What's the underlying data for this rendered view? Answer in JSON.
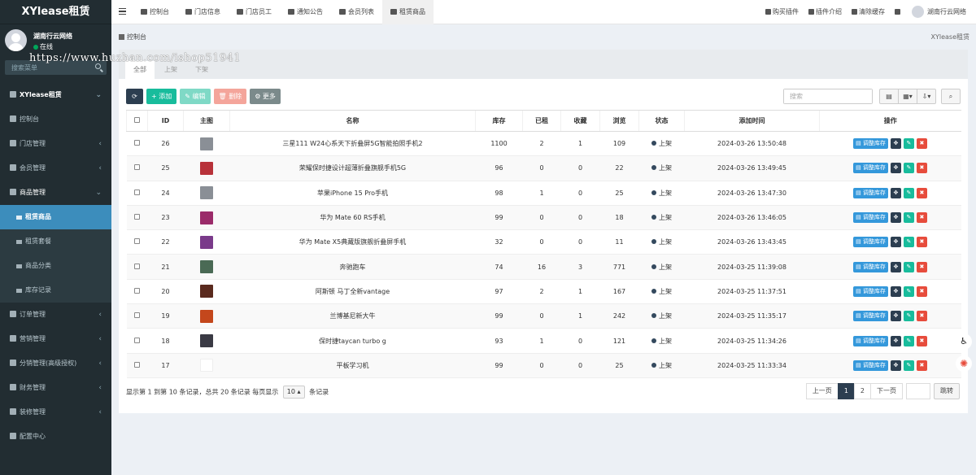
{
  "app": {
    "brand": "XYlease租赁"
  },
  "user": {
    "name": "湖南行云网络",
    "status": "在线"
  },
  "sidebar_search": {
    "placeholder": "搜索菜单"
  },
  "watermark": "https://www.huzhan.com/ishop51941",
  "sidebar": {
    "header": "XYlease租赁",
    "items": [
      {
        "label": "控制台"
      },
      {
        "label": "门店管理"
      },
      {
        "label": "会员管理"
      },
      {
        "label": "商品管理"
      },
      {
        "label": "订单管理"
      },
      {
        "label": "营销管理"
      },
      {
        "label": "分销管理(高级授权)"
      },
      {
        "label": "财务管理"
      },
      {
        "label": "装修管理"
      },
      {
        "label": "配置中心"
      }
    ],
    "sub": [
      {
        "label": "租赁商品"
      },
      {
        "label": "租赁套餐"
      },
      {
        "label": "商品分类"
      },
      {
        "label": "库存记录"
      }
    ]
  },
  "topnav": {
    "tabs": [
      {
        "label": "控制台"
      },
      {
        "label": "门店信息"
      },
      {
        "label": "门店员工"
      },
      {
        "label": "通知公告"
      },
      {
        "label": "会员列表"
      },
      {
        "label": "租赁商品"
      }
    ],
    "right": [
      {
        "label": "购买插件"
      },
      {
        "label": "插件介绍"
      },
      {
        "label": "清除缓存"
      }
    ],
    "user_name": "湖南行云网络"
  },
  "breadcrumb": {
    "label": "控制台",
    "app": "XYlease租赁"
  },
  "panel_tabs": [
    {
      "label": "全部"
    },
    {
      "label": "上架"
    },
    {
      "label": "下架"
    }
  ],
  "toolbar": {
    "add": "添加",
    "edit": "编辑",
    "delete": "删除",
    "more": "更多"
  },
  "search": {
    "placeholder": "搜索"
  },
  "table": {
    "headers": [
      "ID",
      "主图",
      "名称",
      "库存",
      "已租",
      "收藏",
      "浏览",
      "状态",
      "添加时间",
      "操作"
    ],
    "rows": [
      {
        "id": "26",
        "name": "三星111 W24心系天下折叠屏5G智能拍照手机2",
        "stock": "1100",
        "rented": "2",
        "fav": "1",
        "views": "109",
        "status": "上架",
        "time": "2024-03-26 13:50:48",
        "thumb": "#8a8f96"
      },
      {
        "id": "25",
        "name": "荣耀保时捷设计超薄折叠旗舰手机5G",
        "stock": "96",
        "rented": "0",
        "fav": "0",
        "views": "22",
        "status": "上架",
        "time": "2024-03-26 13:49:45",
        "thumb": "#b8323a"
      },
      {
        "id": "24",
        "name": "苹果iPhone 15 Pro手机",
        "stock": "98",
        "rented": "1",
        "fav": "0",
        "views": "25",
        "status": "上架",
        "time": "2024-03-26 13:47:30",
        "thumb": "#8a8f96"
      },
      {
        "id": "23",
        "name": "华为 Mate 60 RS手机",
        "stock": "99",
        "rented": "0",
        "fav": "0",
        "views": "18",
        "status": "上架",
        "time": "2024-03-26 13:46:05",
        "thumb": "#9b2b6a"
      },
      {
        "id": "22",
        "name": "华为 Mate X5典藏版旗舰折叠屏手机",
        "stock": "32",
        "rented": "0",
        "fav": "0",
        "views": "11",
        "status": "上架",
        "time": "2024-03-26 13:43:45",
        "thumb": "#7a3a8a"
      },
      {
        "id": "21",
        "name": "奔驰跑车",
        "stock": "74",
        "rented": "16",
        "fav": "3",
        "views": "771",
        "status": "上架",
        "time": "2024-03-25 11:39:08",
        "thumb": "#4a6a55"
      },
      {
        "id": "20",
        "name": "阿斯顿 马丁全新vantage",
        "stock": "97",
        "rented": "2",
        "fav": "1",
        "views": "167",
        "status": "上架",
        "time": "2024-03-25 11:37:51",
        "thumb": "#5a2a1e"
      },
      {
        "id": "19",
        "name": "兰博基尼新大牛",
        "stock": "99",
        "rented": "0",
        "fav": "1",
        "views": "242",
        "status": "上架",
        "time": "2024-03-25 11:35:17",
        "thumb": "#c4471c"
      },
      {
        "id": "18",
        "name": "保时捷taycan turbo g",
        "stock": "93",
        "rented": "1",
        "fav": "0",
        "views": "121",
        "status": "上架",
        "time": "2024-03-25 11:34:26",
        "thumb": "#3a3a44"
      },
      {
        "id": "17",
        "name": "平板学习机",
        "stock": "99",
        "rented": "0",
        "fav": "0",
        "views": "25",
        "status": "上架",
        "time": "2024-03-25 11:33:34",
        "thumb": "#ffffff"
      }
    ],
    "op_adjust": "调整库存"
  },
  "pager": {
    "info_prefix": "显示第 1 到第 10 条记录，总共 20 条记录 每页显示",
    "page_size": "10",
    "info_suffix": "条记录",
    "prev": "上一页",
    "pages": [
      "1",
      "2"
    ],
    "next": "下一页",
    "jump": "跳转"
  },
  "colors": {
    "sidebar_bg": "#222d32",
    "active": "#3c8dbc",
    "primary_dark": "#2c3e50",
    "success": "#18bc9c",
    "danger": "#e74c3c",
    "info": "#3498db"
  }
}
